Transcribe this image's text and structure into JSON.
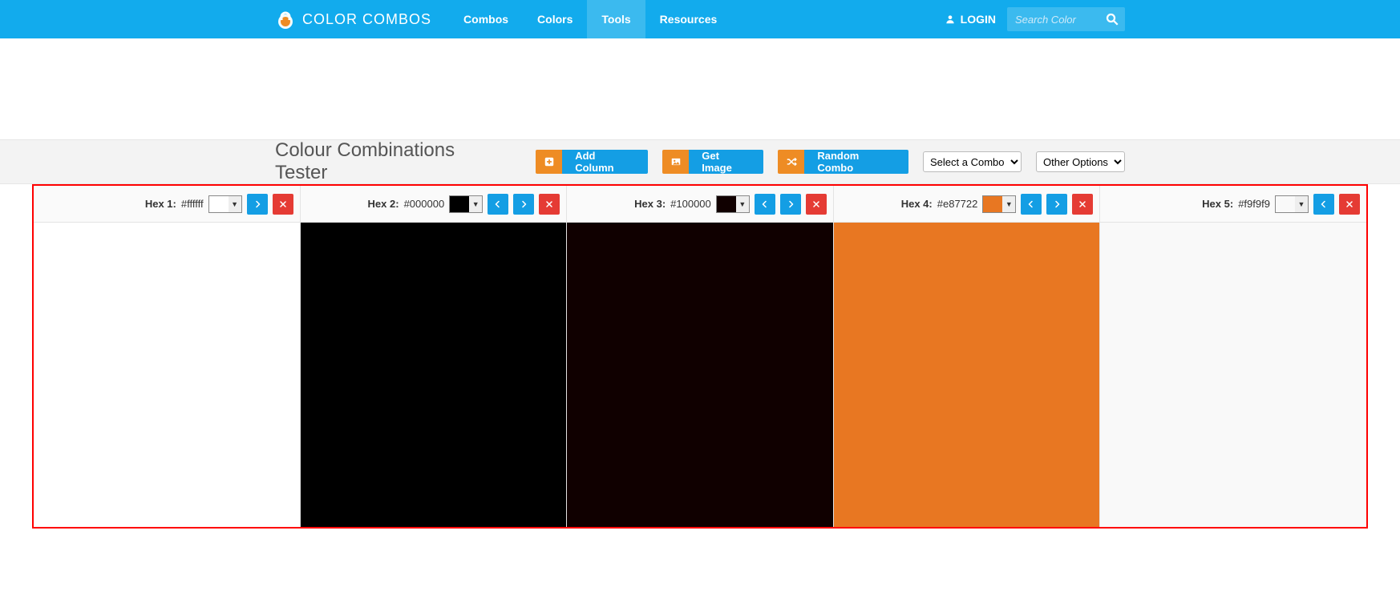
{
  "brand": {
    "name": "COLOR COMBOS"
  },
  "nav": {
    "items": [
      {
        "label": "Combos",
        "active": false
      },
      {
        "label": "Colors",
        "active": false
      },
      {
        "label": "Tools",
        "active": true
      },
      {
        "label": "Resources",
        "active": false
      }
    ],
    "login_label": "LOGIN",
    "search_placeholder": "Search Color"
  },
  "toolbar": {
    "title": "Colour Combinations Tester",
    "add_column": "Add Column",
    "get_image": "Get Image",
    "random_combo": "Random Combo",
    "select_combo": "Select a Combo",
    "other_options": "Other Options"
  },
  "columns": [
    {
      "label": "Hex 1:",
      "hex": "#ffffff",
      "swatch": "#ffffff",
      "show_left": false,
      "show_right": true,
      "show_del": true
    },
    {
      "label": "Hex 2:",
      "hex": "#000000",
      "swatch": "#000000",
      "show_left": true,
      "show_right": true,
      "show_del": true
    },
    {
      "label": "Hex 3:",
      "hex": "#100000",
      "swatch": "#100000",
      "show_left": true,
      "show_right": true,
      "show_del": true
    },
    {
      "label": "Hex 4:",
      "hex": "#e87722",
      "swatch": "#e87722",
      "show_left": true,
      "show_right": true,
      "show_del": true
    },
    {
      "label": "Hex 5:",
      "hex": "#f9f9f9",
      "swatch": "#f9f9f9",
      "show_left": true,
      "show_right": false,
      "show_del": true
    }
  ]
}
